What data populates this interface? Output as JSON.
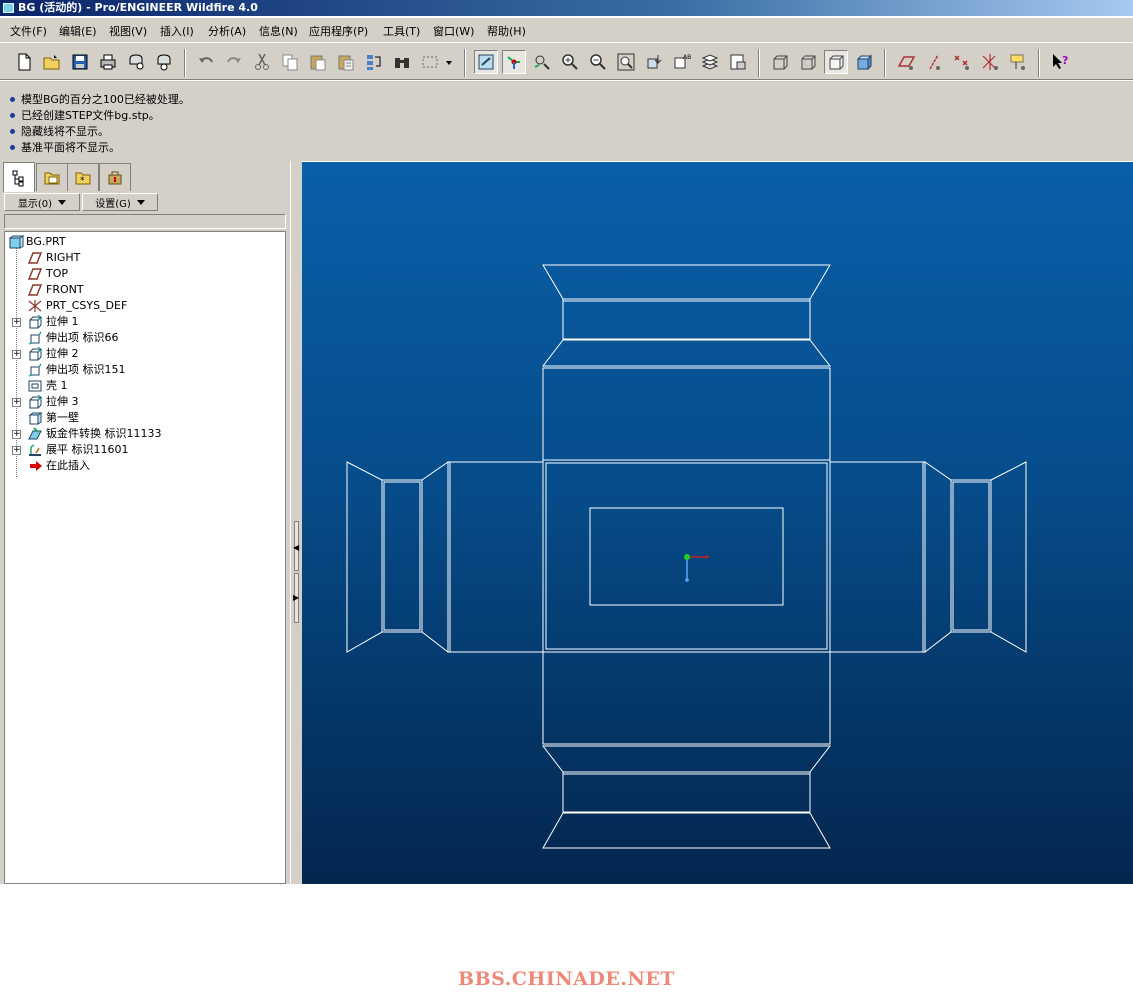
{
  "window": {
    "title": "BG (活动的) - Pro/ENGINEER Wildfire 4.0"
  },
  "menu": [
    "文件(F)",
    "编辑(E)",
    "视图(V)",
    "插入(I)",
    "分析(A)",
    "信息(N)",
    "应用程序(P)",
    "工具(T)",
    "窗口(W)",
    "帮助(H)"
  ],
  "messages": [
    "模型BG的百分之100已经被处理。",
    "已经创建STEP文件bg.stp。",
    "隐藏线将不显示。",
    "基准平面将不显示。"
  ],
  "panel": {
    "show_label": "显示(0)",
    "settings_label": "设置(G)"
  },
  "tree": [
    {
      "label": "BG.PRT",
      "icon": "part-icon"
    },
    {
      "label": "RIGHT",
      "icon": "datum-plane-icon"
    },
    {
      "label": "TOP",
      "icon": "datum-plane-icon"
    },
    {
      "label": "FRONT",
      "icon": "datum-plane-icon"
    },
    {
      "label": "PRT_CSYS_DEF",
      "icon": "csys-icon"
    },
    {
      "label": "拉伸 1",
      "icon": "extrude-icon",
      "expandable": true
    },
    {
      "label": "伸出项 标识66",
      "icon": "protrusion-icon"
    },
    {
      "label": "拉伸 2",
      "icon": "extrude-icon",
      "expandable": true
    },
    {
      "label": "伸出项 标识151",
      "icon": "protrusion-icon"
    },
    {
      "label": "壳 1",
      "icon": "shell-icon"
    },
    {
      "label": "拉伸 3",
      "icon": "extrude-icon",
      "expandable": true
    },
    {
      "label": "第一壁",
      "icon": "first-wall-icon"
    },
    {
      "label": "钣金件转换 标识11133",
      "icon": "sheetmetal-convert-icon",
      "expandable": true
    },
    {
      "label": "展平 标识11601",
      "icon": "unbend-icon",
      "expandable": true
    },
    {
      "label": "在此插入",
      "icon": "insert-here-arrow-icon"
    }
  ],
  "colors": {
    "viewport_top": "#0a5fa8",
    "viewport_bottom": "#03264e",
    "model_lines": "#ffffff",
    "watermark": "#f08878"
  },
  "watermark": "BBS.CHINADE.NET"
}
